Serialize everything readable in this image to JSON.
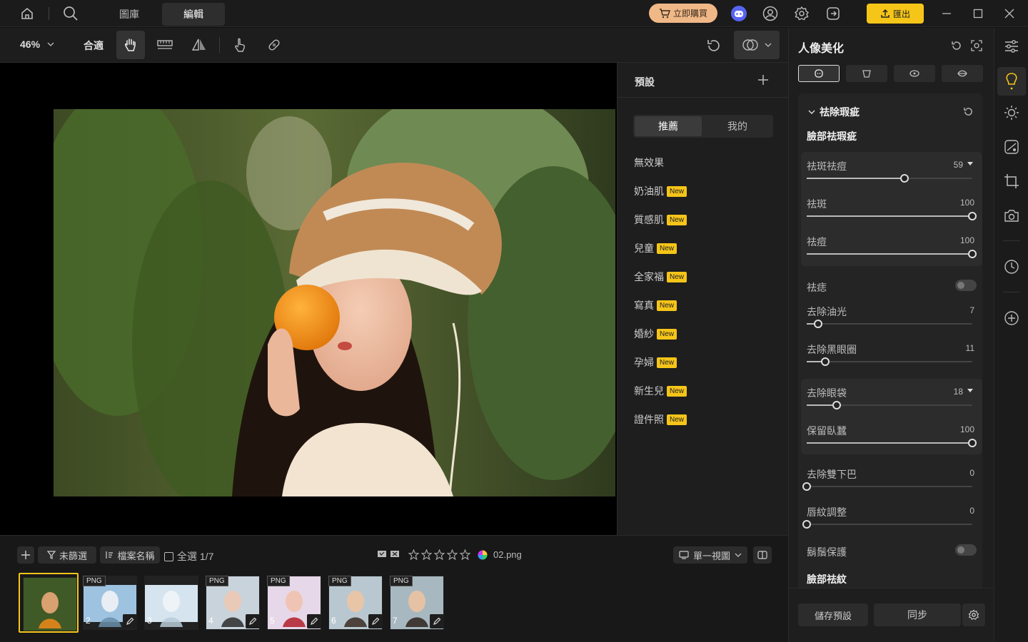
{
  "nav": {
    "tabs": [
      "圖庫",
      "編輯"
    ],
    "active_tab": "編輯",
    "buy_label": "立即購買",
    "export_label": "匯出"
  },
  "toolbar": {
    "zoom": "46%",
    "fit_label": "合適"
  },
  "presets": {
    "title": "預設",
    "seg": [
      "推薦",
      "我的"
    ],
    "items": [
      {
        "label": "無效果",
        "new": false
      },
      {
        "label": "奶油肌",
        "new": true
      },
      {
        "label": "質感肌",
        "new": true
      },
      {
        "label": "兒童",
        "new": true
      },
      {
        "label": "全家福",
        "new": true
      },
      {
        "label": "寫真",
        "new": true
      },
      {
        "label": "婚紗",
        "new": true
      },
      {
        "label": "孕婦",
        "new": true
      },
      {
        "label": "新生兒",
        "new": true
      },
      {
        "label": "證件照",
        "new": true
      }
    ],
    "new_badge": "New"
  },
  "panel": {
    "title": "人像美化",
    "section": "祛除瑕疵",
    "subsection": "臉部祛瑕疵",
    "subsection2": "臉部祛紋",
    "sliders": [
      {
        "label": "祛斑祛痘",
        "value": "59",
        "frac": 0.59
      },
      {
        "label": "祛斑",
        "value": "100",
        "frac": 1.0
      },
      {
        "label": "祛痘",
        "value": "100",
        "frac": 1.0
      },
      {
        "label": "去除油光",
        "value": "7",
        "frac": 0.07
      },
      {
        "label": "去除黑眼圈",
        "value": "11",
        "frac": 0.11
      },
      {
        "label": "去除眼袋",
        "value": "18",
        "frac": 0.18
      },
      {
        "label": "保留臥蠶",
        "value": "100",
        "frac": 1.0
      },
      {
        "label": "去除雙下巴",
        "value": "0",
        "frac": 0
      },
      {
        "label": "唇紋調整",
        "value": "0",
        "frac": 0
      }
    ],
    "toggles": [
      {
        "label": "祛痣"
      },
      {
        "label": "鬍鬚保護"
      }
    ],
    "save_preset": "儲存預設",
    "sync": "同步"
  },
  "film": {
    "filter": "未篩選",
    "sort": "檔案名稱",
    "select_all": "全選 1/7",
    "filename": "02.png",
    "view": "單一視圖",
    "thumbs": [
      {
        "n": "",
        "png": false
      },
      {
        "n": "2",
        "png": true
      },
      {
        "n": "3",
        "png": false
      },
      {
        "n": "4",
        "png": true
      },
      {
        "n": "5",
        "png": true
      },
      {
        "n": "6",
        "png": true
      },
      {
        "n": "7",
        "png": true
      }
    ],
    "png_label": "PNG"
  },
  "colors": {
    "accent": "#f5c518",
    "buy_bg": "#f0b887"
  }
}
